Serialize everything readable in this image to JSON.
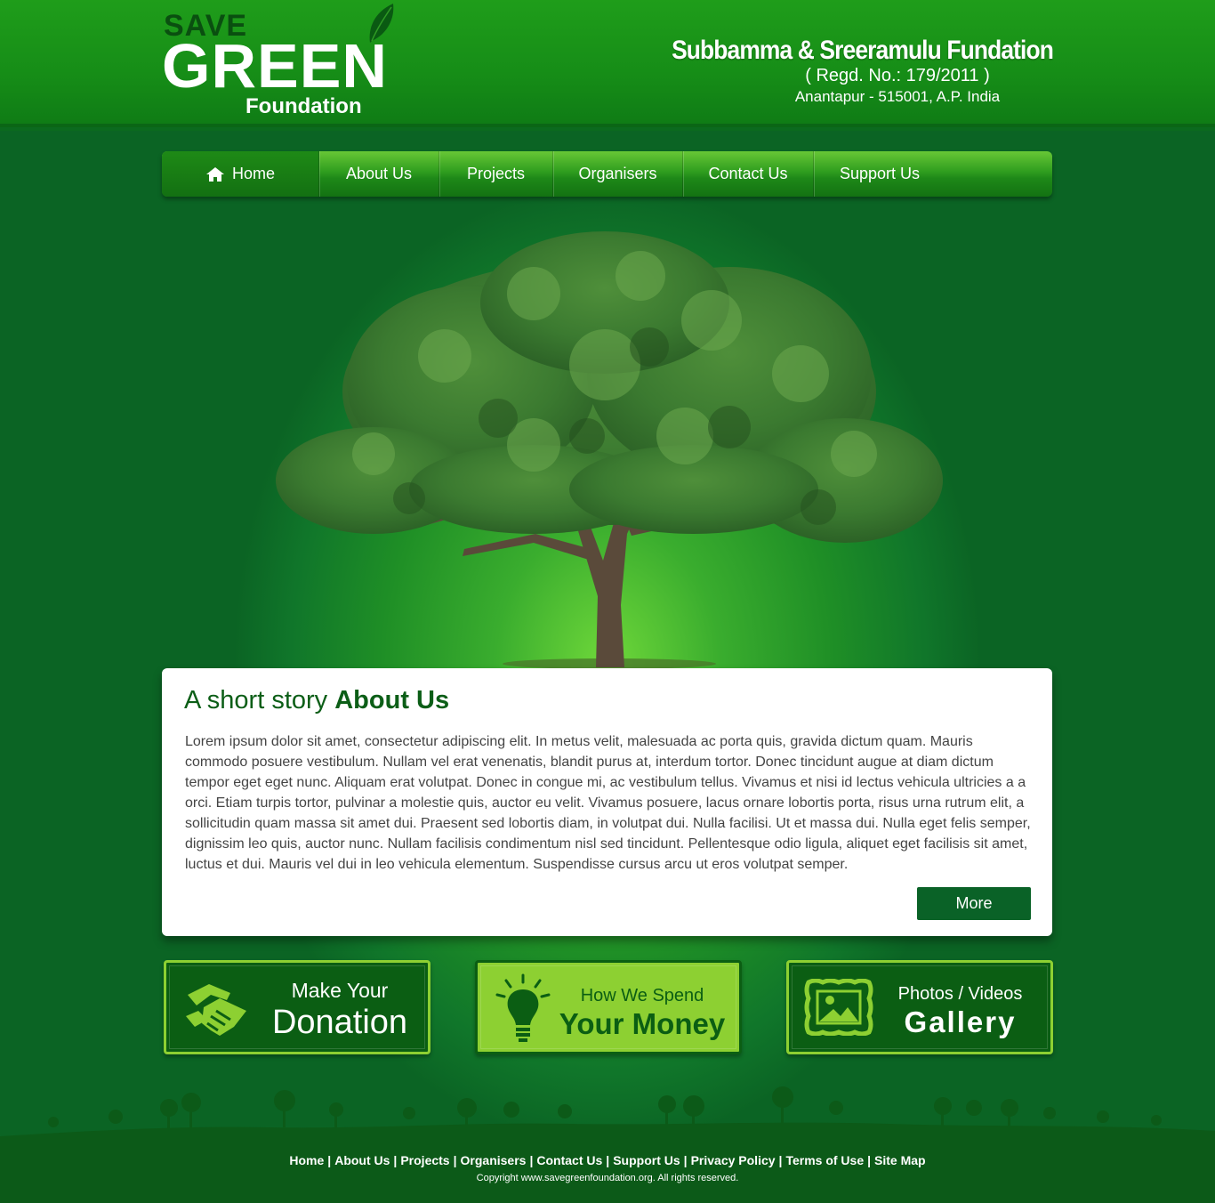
{
  "logo": {
    "save": "SAVE",
    "green": "GREEN",
    "foundation": "Foundation"
  },
  "org": {
    "name": "Subbamma & Sreeramulu Fundation",
    "regd": "( Regd. No.: 179/2011 )",
    "address": "Anantapur - 515001, A.P. India"
  },
  "nav": {
    "items": [
      {
        "label": "Home",
        "icon": "home-icon"
      },
      {
        "label": "About Us"
      },
      {
        "label": "Projects"
      },
      {
        "label": "Organisers"
      },
      {
        "label": "Contact Us"
      },
      {
        "label": "Support Us"
      }
    ]
  },
  "about": {
    "title_prefix": "A short story ",
    "title_bold": "About Us",
    "body": "Lorem ipsum dolor sit amet, consectetur adipiscing elit. In metus velit, malesuada ac porta quis, gravida dictum quam. Mauris commodo posuere vestibulum. Nullam vel erat venenatis, blandit purus at, interdum tortor. Donec tincidunt augue at diam dictum tempor eget eget nunc. Aliquam erat volutpat. Donec in congue mi, ac vestibulum tellus. Vivamus et nisi id lectus vehicula ultricies a a orci. Etiam turpis tortor, pulvinar a molestie quis, auctor eu velit. Vivamus posuere, lacus ornare lobortis porta, risus urna rutrum elit, a sollicitudin quam massa sit amet dui. Praesent sed lobortis diam, in volutpat dui.  Nulla facilisi. Ut et massa dui. Nulla eget felis semper, dignissim leo quis, auctor nunc. Nullam facilisis condimentum nisl sed tincidunt. Pellentesque odio ligula, aliquet eget facilisis sit amet, luctus et dui. Mauris vel dui in leo vehicula elementum. Suspendisse cursus arcu ut eros volutpat semper.",
    "more_label": "More"
  },
  "promos": {
    "donation": {
      "line1": "Make Your",
      "line2": "Donation",
      "icon": "handshake-icon"
    },
    "money": {
      "line1": "How We Spend",
      "line2": "Your Money",
      "icon": "lightbulb-icon"
    },
    "gallery": {
      "line1": "Photos / Videos",
      "line2": "Gallery",
      "icon": "picture-frame-icon"
    }
  },
  "footer": {
    "links": [
      "Home",
      "About Us",
      "Projects",
      "Organisers",
      "Contact Us",
      "Support Us",
      "Privacy Policy",
      "Terms of Use",
      "Site Map"
    ],
    "separator": "|",
    "copyright": "Copyright www.savegreenfoundation.org. All rights reserved."
  },
  "colors": {
    "header_green": "#1f9d1a",
    "dark_green": "#0b5e13",
    "light_green": "#8dd032",
    "button_green": "#0a6227"
  }
}
